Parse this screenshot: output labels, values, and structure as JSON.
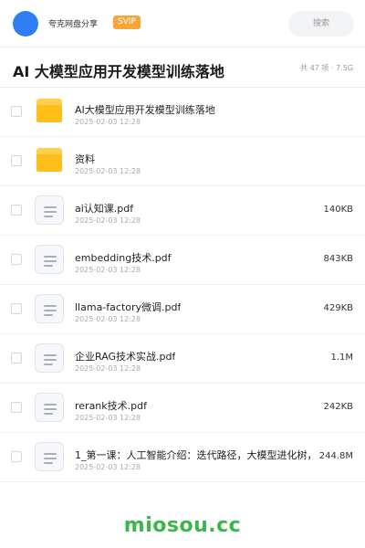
{
  "header": {
    "user_name": "夸克网盘分享",
    "badge": "SVIP",
    "search_placeholder": "搜索"
  },
  "folder": {
    "title": "AI 大模型应用开发模型训练落地",
    "meta": "共 47 项 · 7.5G"
  },
  "files": [
    {
      "name": "AI大模型应用开发模型训练落地",
      "date": "2025-02-03 12:28",
      "size": "",
      "type": "folder"
    },
    {
      "name": "资料",
      "date": "2025-02-03 12:28",
      "size": "",
      "type": "folder"
    },
    {
      "name": "ai认知课.pdf",
      "date": "2025-02-03 12:28",
      "size": "140KB",
      "type": "doc"
    },
    {
      "name": "embedding技术.pdf",
      "date": "2025-02-03 12:28",
      "size": "843KB",
      "type": "doc"
    },
    {
      "name": "llama-factory微调.pdf",
      "date": "2025-02-03 12:28",
      "size": "429KB",
      "type": "doc"
    },
    {
      "name": "企业RAG技术实战.pdf",
      "date": "2025-02-03 12:28",
      "size": "1.1M",
      "type": "doc"
    },
    {
      "name": "rerank技术.pdf",
      "date": "2025-02-03 12:28",
      "size": "242KB",
      "type": "doc"
    },
    {
      "name": "1_第一课：人工智能介绍：迭代路径，大模型进化树，",
      "date": "2025-02-03 12:28",
      "size": "244.8M",
      "type": "doc"
    }
  ],
  "watermark": "miosou.cc",
  "colors": {
    "avatar": "#2f7ef5",
    "badge": "#f7a43a",
    "folder": "#ffbe1a",
    "watermark": "#3cb54a"
  }
}
